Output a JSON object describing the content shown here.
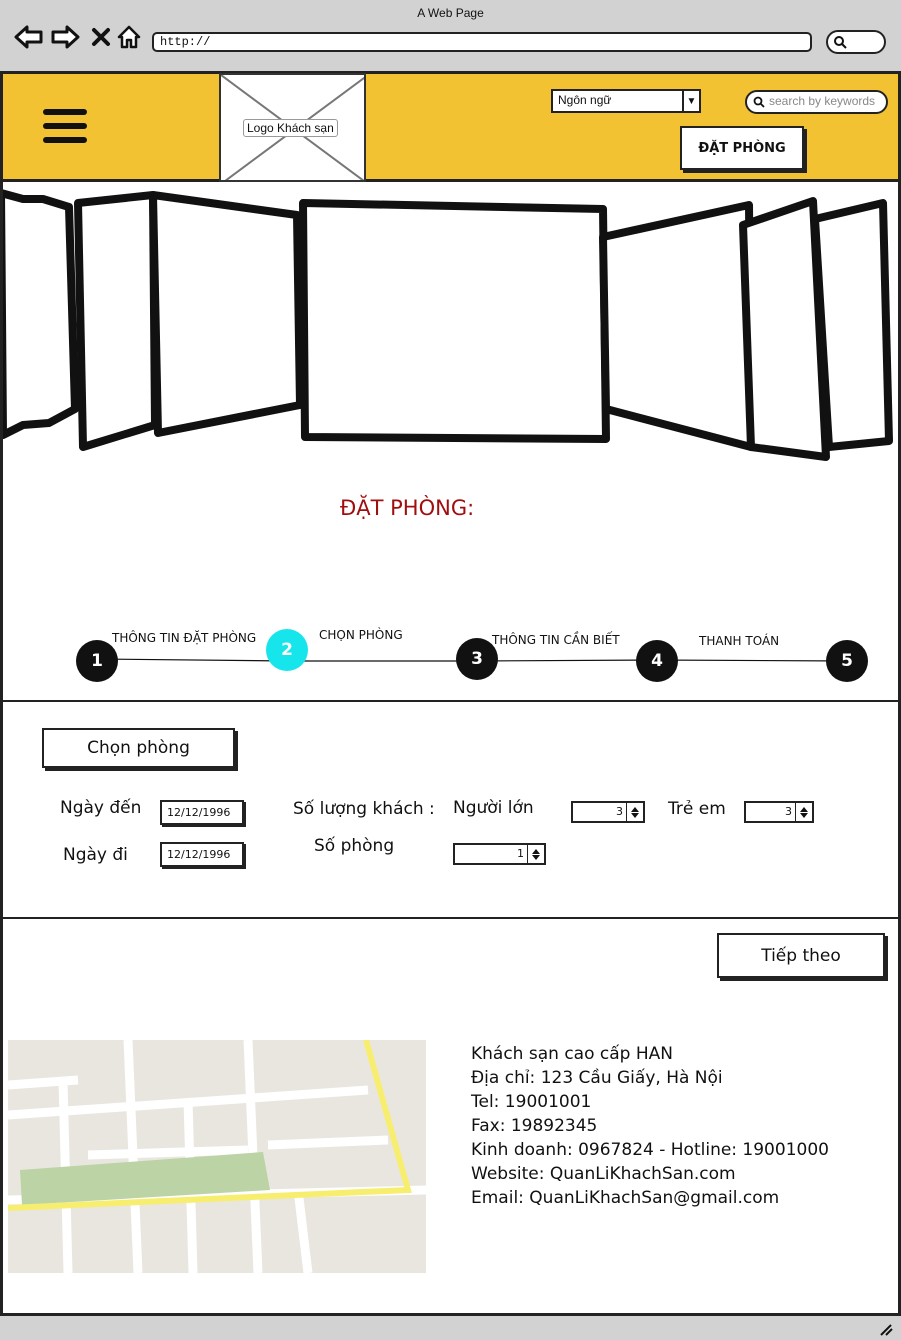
{
  "window": {
    "title": "A Web Page"
  },
  "browser": {
    "url": "http://"
  },
  "header": {
    "logo_text": "Logo Khách sạn",
    "language_select": "Ngôn ngữ",
    "search_placeholder": "search by keywords",
    "book_button": "ĐẶT PHÒNG"
  },
  "booking": {
    "title": "ĐẶT PHÒNG:",
    "steps": [
      {
        "number": "1",
        "label": "THÔNG TIN ĐẶT PHÒNG"
      },
      {
        "number": "2",
        "label": "CHỌN PHÒNG",
        "active": true
      },
      {
        "number": "3",
        "label": "THÔNG TIN CẦN BIẾT"
      },
      {
        "number": "4",
        "label": "THANH TOÁN"
      },
      {
        "number": "5",
        "label": ""
      }
    ],
    "active_color": "#16e6ec"
  },
  "form": {
    "section_button": "Chọn phòng",
    "arrival_label": "Ngày đến",
    "arrival_value": "12/12/1996",
    "departure_label": "Ngày đi",
    "departure_value": "12/12/1996",
    "guests_label": "Số lượng khách :",
    "adults_label": "Người lớn",
    "adults_value": "3",
    "children_label": "Trẻ em",
    "children_value": "3",
    "rooms_label": "Số phòng",
    "rooms_value": "1",
    "next_button": "Tiếp theo"
  },
  "contact": {
    "name": "Khách sạn cao cấp HAN",
    "address": "Địa chỉ: 123 Cầu Giấy, Hà Nội",
    "tel": "Tel: 19001001",
    "fax": "Fax: 19892345",
    "business": "Kinh doanh: 0967824 - Hotline: 19001000",
    "website": "Website: QuanLiKhachSan.com",
    "email": "Email: QuanLiKhachSan@gmail.com"
  },
  "colors": {
    "header_bg": "#f2c232",
    "title_red": "#a00f0f",
    "chrome_gray": "#d2d2d2"
  }
}
